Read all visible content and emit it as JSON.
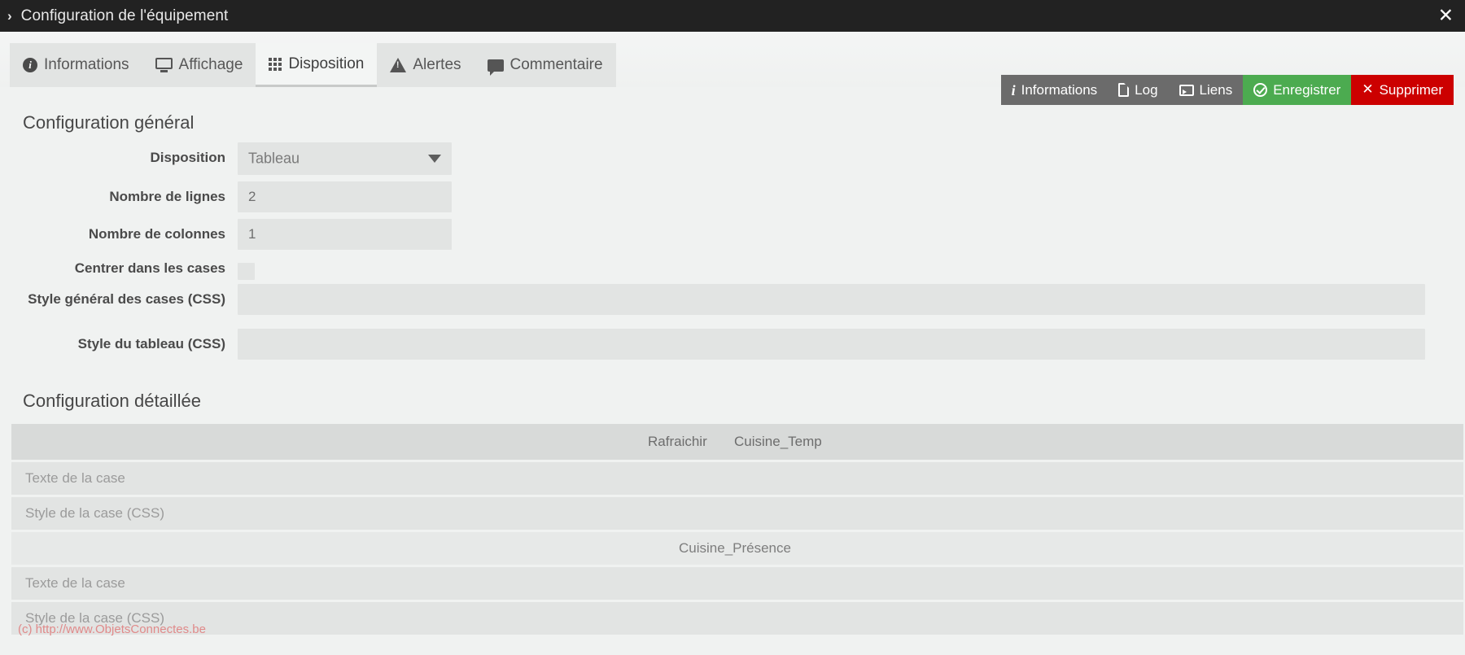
{
  "window": {
    "title": "Configuration de l'équipement",
    "expand_chevron": "›",
    "close_label": "✕"
  },
  "tabs": [
    {
      "label": "Informations",
      "icon": "info-circle-icon",
      "active": false
    },
    {
      "label": "Affichage",
      "icon": "monitor-icon",
      "active": false
    },
    {
      "label": "Disposition",
      "icon": "grid-icon",
      "active": true
    },
    {
      "label": "Alertes",
      "icon": "warning-icon",
      "active": false
    },
    {
      "label": "Commentaire",
      "icon": "comment-icon",
      "active": false
    }
  ],
  "actions": [
    {
      "label": "Informations",
      "icon": "info-icon",
      "style": "grey"
    },
    {
      "label": "Log",
      "icon": "file-icon",
      "style": "grey"
    },
    {
      "label": "Liens",
      "icon": "link-icon",
      "style": "grey"
    },
    {
      "label": "Enregistrer",
      "icon": "check-circle-icon",
      "style": "green"
    },
    {
      "label": "Supprimer",
      "icon": "close-icon",
      "style": "red"
    }
  ],
  "general": {
    "heading": "Configuration général",
    "fields": {
      "disposition_label": "Disposition",
      "disposition_value": "Tableau",
      "rows_label": "Nombre de lignes",
      "rows_value": "2",
      "cols_label": "Nombre de colonnes",
      "cols_value": "1",
      "center_label": "Centrer dans les cases",
      "cells_css_label": "Style général des cases (CSS)",
      "cells_css_value": "",
      "table_css_label": "Style du tableau (CSS)",
      "table_css_value": ""
    }
  },
  "detail": {
    "heading": "Configuration détaillée",
    "group1": {
      "columns": [
        "Rafraichir",
        "Cuisine_Temp"
      ],
      "rows": [
        {
          "placeholder": "Texte de la case"
        },
        {
          "placeholder": "Style de la case (CSS)"
        }
      ]
    },
    "group2": {
      "columns": [
        "Cuisine_Présence"
      ],
      "rows": [
        {
          "placeholder": "Texte de la case"
        },
        {
          "placeholder": "Style de la case (CSS)"
        }
      ]
    }
  },
  "footer": {
    "watermark": "(c) http://www.ObjetsConnectes.be"
  },
  "colors": {
    "titlebar": "#222222",
    "accent_green": "#4cab50",
    "accent_red": "#cc0000",
    "action_grey": "#6b6b6b",
    "field_bg": "#e2e4e3",
    "page_bg": "#f0f2f1",
    "watermark": "#e08a8a"
  }
}
